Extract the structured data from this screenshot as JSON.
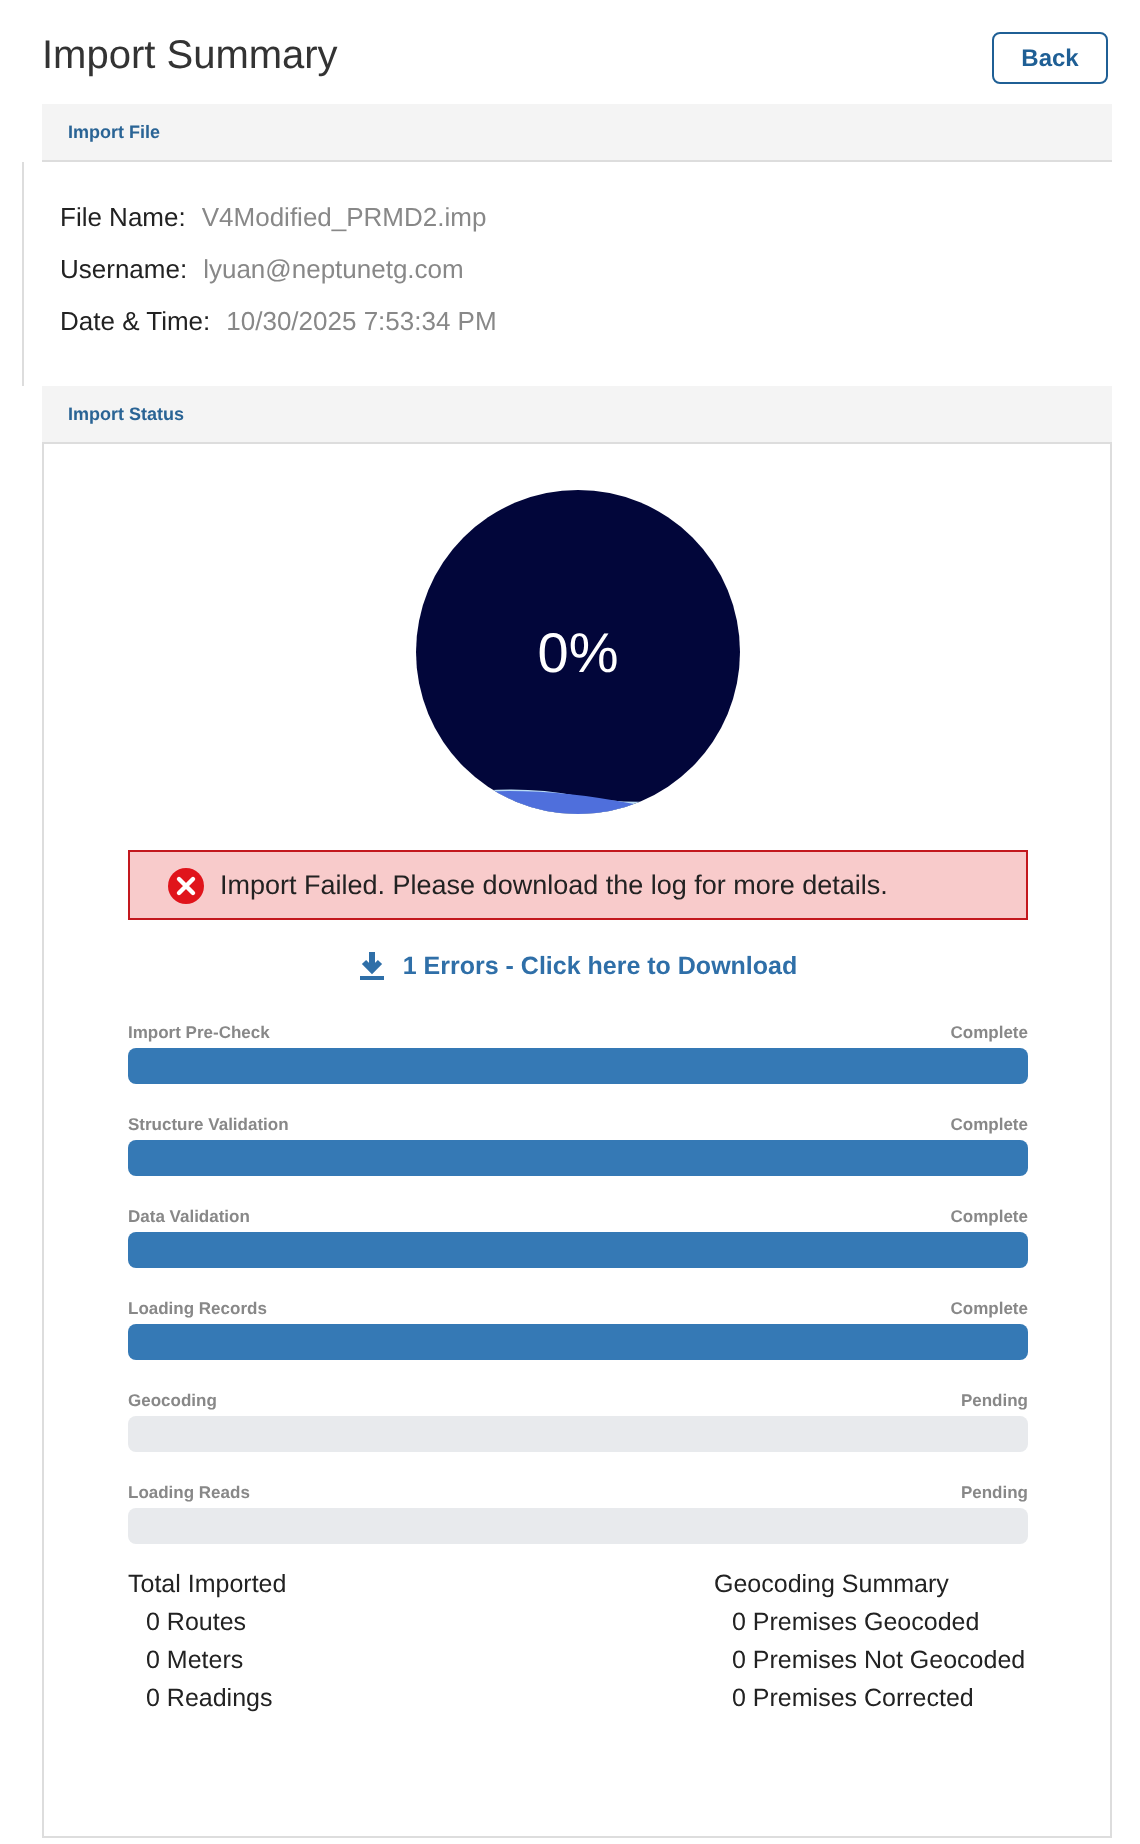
{
  "page": {
    "title": "Import Summary",
    "back_button": "Back"
  },
  "import_file": {
    "header": "Import File",
    "fields": [
      {
        "label": "File Name:",
        "value": "V4Modified_PRMD2.imp"
      },
      {
        "label": "Username:",
        "value": "lyuan@neptunetg.com"
      },
      {
        "label": "Date & Time:",
        "value": "10/30/2025 7:53:34 PM"
      }
    ]
  },
  "import_status": {
    "header": "Import Status",
    "gauge": {
      "reading": "0%"
    },
    "alert": {
      "kind": "error",
      "message": "Import Failed. Please download the log for more details."
    },
    "download_link": "1 Errors - Click here to Download",
    "steps": [
      {
        "label": "Import Pre-Check",
        "status": "Complete",
        "done": true
      },
      {
        "label": "Structure Validation",
        "status": "Complete",
        "done": true
      },
      {
        "label": "Data Validation",
        "status": "Complete",
        "done": true
      },
      {
        "label": "Loading Records",
        "status": "Complete",
        "done": true
      },
      {
        "label": "Geocoding",
        "status": "Pending",
        "done": false
      },
      {
        "label": "Loading Reads",
        "status": "Pending",
        "done": false
      }
    ],
    "summaries": [
      {
        "title": "Total Imported",
        "items": [
          "0 Routes",
          "0 Meters",
          "0 Readings"
        ]
      },
      {
        "title": "Geocoding Summary",
        "items": [
          "0 Premises Geocoded",
          "0 Premises Not Geocoded",
          "0 Premises Corrected"
        ]
      }
    ]
  }
}
